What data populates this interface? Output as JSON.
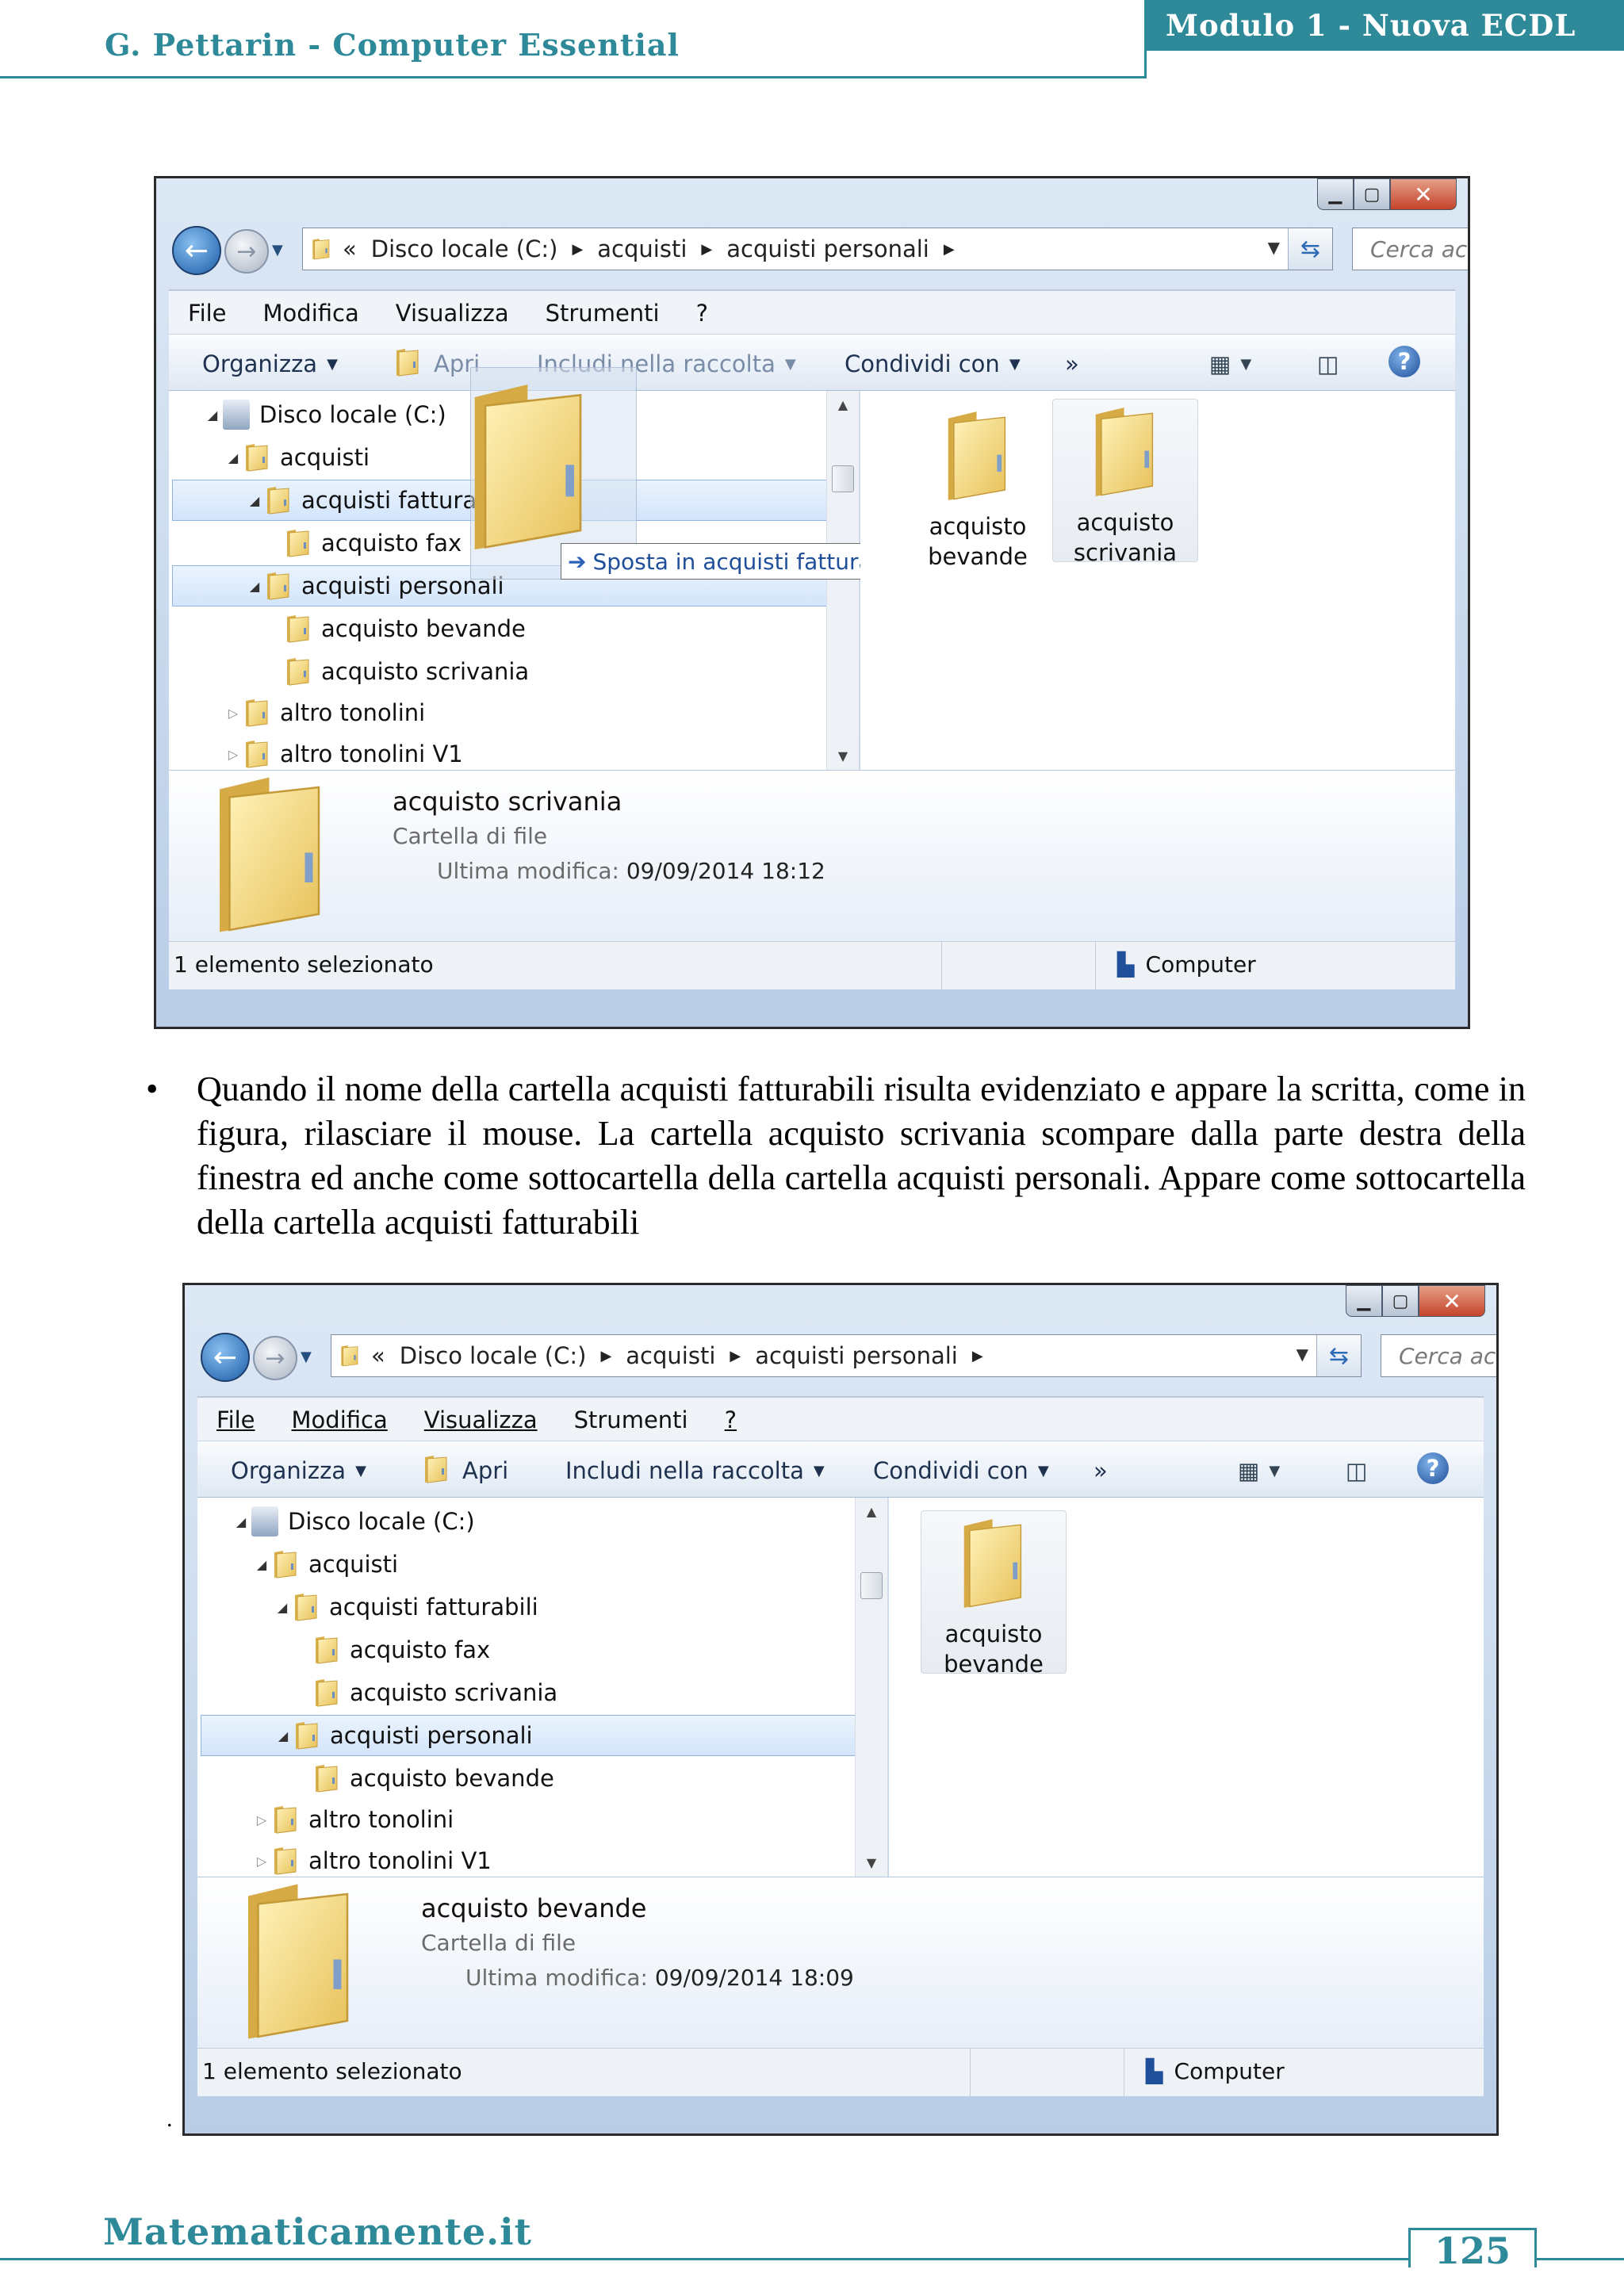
{
  "header": {
    "author_title": "G. Pettarin - Computer Essential",
    "module": "Modulo 1 - Nuova ECDL"
  },
  "footer": {
    "site": "Matematicamente.it",
    "page": "125"
  },
  "paragraph": "Quando il nome della cartella acquisti fatturabili risulta evidenziato e appare la scritta, come in figura, rilasciare il mouse. La cartella acquisto scrivania scompare dalla parte destra della finestra ed anche come sottocartella della cartella acquisti personali. Appare come sottocartella della cartella acquisti fatturabili",
  "bullet": "•",
  "stray_dot": ".",
  "colors": {
    "accent": "#2e8a99"
  },
  "window1": {
    "address": {
      "chevron": "«",
      "segments": [
        "Disco locale (C:)",
        "acquisti",
        "acquisti personali"
      ]
    },
    "search_placeholder": "Cerca acqu...",
    "menu": [
      "File",
      "Modifica",
      "Visualizza",
      "Strumenti",
      "?"
    ],
    "toolbar": {
      "organize": "Organizza",
      "open": "Apri",
      "include": "Includi nella raccolta",
      "share": "Condividi con",
      "more": "»"
    },
    "tree": [
      "Disco locale (C:)",
      "acquisti",
      "acquisti fatturabili",
      "acquisto fax",
      "acquisti personali",
      "acquisto bevande",
      "acquisto scrivania",
      "altro tonolini",
      "altro tonolini V1"
    ],
    "tree_visible_labels": {
      "fatturabili": "acquisti fatturab"
    },
    "tooltip": "Sposta in acquisti fatturabili",
    "files": [
      {
        "line1": "acquisto",
        "line2": "bevande"
      },
      {
        "line1": "acquisto",
        "line2": "scrivania"
      }
    ],
    "details": {
      "name": "acquisto scrivania",
      "type": "Cartella di file",
      "modified_label": "Ultima modifica:",
      "modified_value": "09/09/2014 18:12"
    },
    "status": {
      "selected": "1 elemento selezionato",
      "location": "Computer"
    }
  },
  "window2": {
    "address": {
      "chevron": "«",
      "segments": [
        "Disco locale (C:)",
        "acquisti",
        "acquisti personali"
      ]
    },
    "search_placeholder": "Cerca acqu...",
    "menu": [
      "File",
      "Modifica",
      "Visualizza",
      "Strumenti",
      "?"
    ],
    "toolbar": {
      "organize": "Organizza",
      "open": "Apri",
      "include": "Includi nella raccolta",
      "share": "Condividi con",
      "more": "»"
    },
    "tree": [
      "Disco locale (C:)",
      "acquisti",
      "acquisti fatturabili",
      "acquisto fax",
      "acquisto scrivania",
      "acquisti personali",
      "acquisto bevande",
      "altro tonolini",
      "altro tonolini V1"
    ],
    "files": [
      {
        "line1": "acquisto",
        "line2": "bevande"
      }
    ],
    "details": {
      "name": "acquisto bevande",
      "type": "Cartella di file",
      "modified_label": "Ultima modifica:",
      "modified_value": "09/09/2014 18:09"
    },
    "status": {
      "selected": "1 elemento selezionato",
      "location": "Computer"
    }
  }
}
